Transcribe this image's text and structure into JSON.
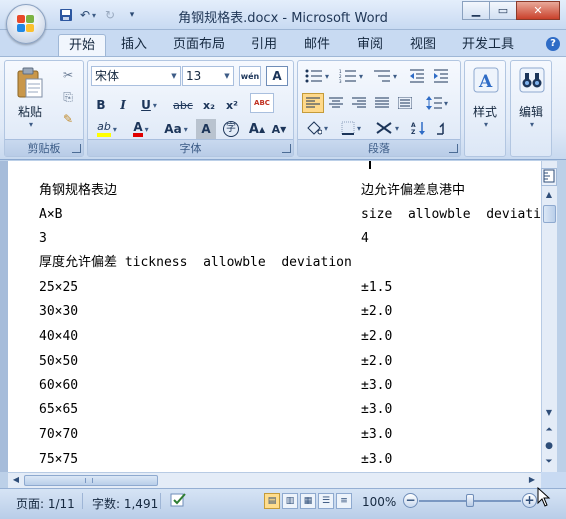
{
  "window": {
    "title": "角钢规格表.docx - Microsoft Word",
    "min_glyph": "▁",
    "max_glyph": "▭",
    "close_glyph": "✕"
  },
  "qat": {
    "save_glyph": "▪",
    "undo_glyph": "↶",
    "redo_glyph": "↻",
    "customize_glyph": "▾"
  },
  "tabs": [
    "开始",
    "插入",
    "页面布局",
    "引用",
    "邮件",
    "审阅",
    "视图",
    "开发工具"
  ],
  "help_glyph": "?",
  "ribbon": {
    "clipboard": {
      "label": "剪贴板",
      "paste_label": "粘贴",
      "cut_glyph": "✂",
      "copy_glyph": "⎘",
      "painter_glyph": "✎"
    },
    "font": {
      "label": "字体",
      "font_name": "宋体",
      "font_size": "13",
      "bold": "B",
      "italic": "I",
      "underline": "U",
      "strike": "abc",
      "subscript": "x₂",
      "superscript": "x²",
      "highlight": "ab",
      "font_color": "A",
      "change_case": "Aa",
      "char_shading": "A",
      "enclose": "字",
      "grow": "A",
      "shrink": "A",
      "phonetic": "wén",
      "border_char": "A",
      "clear_format": "ABC"
    },
    "paragraph": {
      "label": "段落"
    },
    "styles": {
      "label": "样式"
    },
    "editing": {
      "label": "编辑"
    }
  },
  "document": {
    "rows": [
      [
        "角钢规格表边",
        "边允许偏差息港中"
      ],
      [
        "A×B",
        "size  allowble  deviation"
      ],
      [
        "3",
        "4"
      ],
      [
        "厚度允许偏差 tickness  allowble  deviation",
        ""
      ],
      [
        "25×25",
        "±1.5"
      ],
      [
        "30×30",
        "±2.0"
      ],
      [
        "40×40",
        "±2.0"
      ],
      [
        "50×50",
        "±2.0"
      ],
      [
        "60×60",
        "±3.0"
      ],
      [
        "65×65",
        "±3.0"
      ],
      [
        "70×70",
        "±3.0"
      ],
      [
        "75×75",
        "±3.0"
      ]
    ]
  },
  "statusbar": {
    "page": "页面: 1/11",
    "words": "字数: 1,491",
    "zoom": "100%",
    "zoom_out": "−",
    "zoom_in": "+"
  },
  "colors": {
    "highlight": "#ffff00",
    "font_color": "#e00000",
    "office_logo": [
      "#e8492a",
      "#7cb342",
      "#1e88e5",
      "#fbc02d"
    ]
  }
}
